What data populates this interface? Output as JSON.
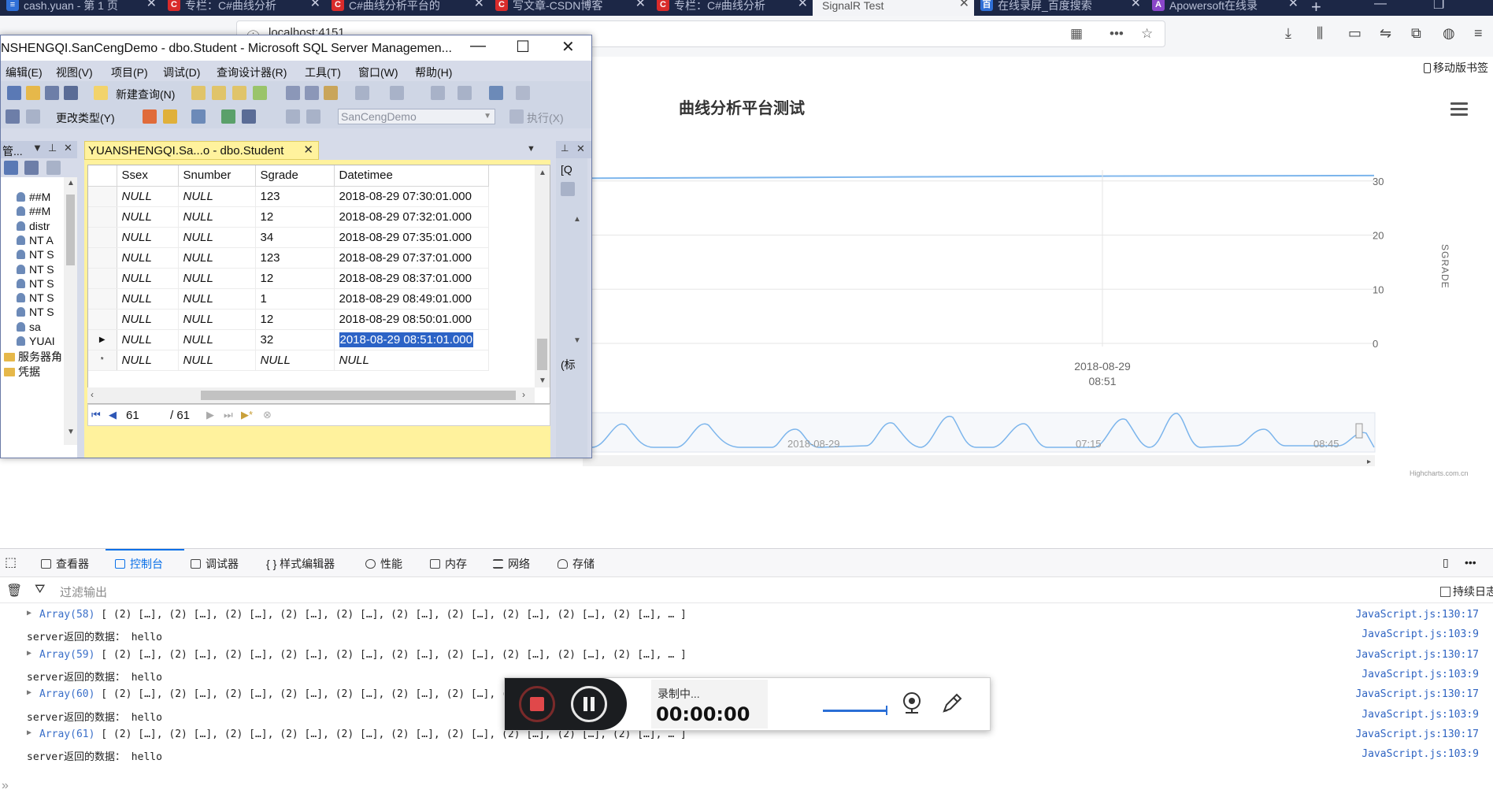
{
  "browser": {
    "tabs": [
      {
        "label": "cash.yuan - 第 1 页",
        "icon": "text-icon"
      },
      {
        "label": "专栏：C#曲线分析",
        "icon": "csdn-icon"
      },
      {
        "label": "C#曲线分析平台的",
        "icon": "csdn-icon"
      },
      {
        "label": "写文章-CSDN博客",
        "icon": "csdn-icon"
      },
      {
        "label": "专栏：C#曲线分析",
        "icon": "csdn-icon"
      },
      {
        "label": "SignalR Test",
        "icon": "none",
        "active": true
      },
      {
        "label": "在线录屏_百度搜索",
        "icon": "baidu-icon"
      },
      {
        "label": "Apowersoft在线录",
        "icon": "apowersoft-icon"
      }
    ],
    "url": "localhost:4151",
    "mobile_bookmarks": "移动版书签"
  },
  "chart": {
    "title": "曲线分析平台测试",
    "y_axis_title": "SGRADE",
    "credits": "Highcharts.com.cn",
    "nav_labels": [
      "2018-08-29",
      "07:15",
      "08:45"
    ]
  },
  "chart_data": {
    "type": "line",
    "title": "曲线分析平台测试",
    "ylabel": "SGRADE",
    "y_ticks": [
      0,
      10,
      20,
      30
    ],
    "ylim": [
      0,
      32
    ],
    "x_tick_label": [
      "2018-08-29",
      "08:51"
    ],
    "series": [
      {
        "values": [
          30.5,
          30.7,
          30.9,
          31.0
        ]
      }
    ]
  },
  "ssms": {
    "title": "NSHENGQI.SanCengDemo - dbo.Student - Microsoft SQL Server Managemen...",
    "menu": [
      "编辑(E)",
      "视图(V)",
      "项目(P)",
      "调试(D)",
      "查询设计器(R)",
      "工具(T)",
      "窗口(W)",
      "帮助(H)"
    ],
    "toolbar": {
      "new_query": "新建查询(N)",
      "change_type": "更改类型(Y)",
      "database": "SanCengDemo",
      "execute": "执行(X)"
    },
    "explorer": {
      "header": "管...",
      "items": [
        {
          "label": "##M",
          "type": "user"
        },
        {
          "label": "##M",
          "type": "user"
        },
        {
          "label": "distr",
          "type": "user"
        },
        {
          "label": "NT A",
          "type": "user"
        },
        {
          "label": "NT S",
          "type": "user"
        },
        {
          "label": "NT S",
          "type": "user"
        },
        {
          "label": "NT S",
          "type": "user"
        },
        {
          "label": "NT S",
          "type": "user"
        },
        {
          "label": "NT S",
          "type": "user"
        },
        {
          "label": "sa",
          "type": "user"
        },
        {
          "label": "YUAI",
          "type": "user"
        },
        {
          "label": "服务器角",
          "type": "folder"
        },
        {
          "label": "凭据",
          "type": "folder"
        }
      ]
    },
    "doc_tab": "YUANSHENGQI.Sa...o - dbo.Student",
    "grid": {
      "columns": [
        "Ssex",
        "Snumber",
        "Sgrade",
        "Datetimee"
      ],
      "rows": [
        [
          "NULL",
          "NULL",
          "123",
          "2018-08-29 07:30:01.000"
        ],
        [
          "NULL",
          "NULL",
          "12",
          "2018-08-29 07:32:01.000"
        ],
        [
          "NULL",
          "NULL",
          "34",
          "2018-08-29 07:35:01.000"
        ],
        [
          "NULL",
          "NULL",
          "123",
          "2018-08-29 07:37:01.000"
        ],
        [
          "NULL",
          "NULL",
          "12",
          "2018-08-29 08:37:01.000"
        ],
        [
          "NULL",
          "NULL",
          "1",
          "2018-08-29 08:49:01.000"
        ],
        [
          "NULL",
          "NULL",
          "12",
          "2018-08-29 08:50:01.000"
        ],
        [
          "NULL",
          "NULL",
          "32",
          "2018-08-29 08:51:01.000"
        ],
        [
          "NULL",
          "NULL",
          "NULL",
          "NULL"
        ]
      ]
    },
    "nav": {
      "current": "61",
      "total": "/ 61"
    },
    "side_panel": [
      "[Q",
      "(标"
    ]
  },
  "devtools": {
    "tabs": [
      {
        "label": "查看器",
        "icon": "inspector-icon"
      },
      {
        "label": "控制台",
        "icon": "console-icon",
        "active": true
      },
      {
        "label": "调试器",
        "icon": "debugger-icon"
      },
      {
        "label": "{ } 样式编辑器",
        "icon": "style-icon"
      },
      {
        "label": "性能",
        "icon": "performance-icon"
      },
      {
        "label": "内存",
        "icon": "memory-icon"
      },
      {
        "label": "网络",
        "icon": "network-icon"
      },
      {
        "label": "存储",
        "icon": "storage-icon"
      }
    ],
    "filter_placeholder": "过滤输出",
    "persist_logs": "持续日志",
    "logs": [
      {
        "kind": "array",
        "name": "Array(58)",
        "body": " [ (2) […], (2) […], (2) […], (2) […], (2) […], (2) […], (2) […], (2) […], (2) […], (2) […], … ]",
        "src": "JavaScript.js:130:17"
      },
      {
        "kind": "msg",
        "body": "server返回的数据：  hello",
        "src": "JavaScript.js:103:9"
      },
      {
        "kind": "array",
        "name": "Array(59)",
        "body": " [ (2) […], (2) […], (2) […], (2) […], (2) […], (2) […], (2) […], (2) […], (2) […], (2) […], … ]",
        "src": "JavaScript.js:130:17"
      },
      {
        "kind": "msg",
        "body": "server返回的数据：  hello",
        "src": "JavaScript.js:103:9"
      },
      {
        "kind": "array",
        "name": "Array(60)",
        "body": " [ (2) […], (2) […], (2) […], (2) […], (2) […], (2) […], (2) […], (2) […], (2) […], (2) […], … ]",
        "src": "JavaScript.js:130:17"
      },
      {
        "kind": "msg",
        "body": "server返回的数据：  hello",
        "src": "JavaScript.js:103:9"
      },
      {
        "kind": "array",
        "name": "Array(61)",
        "body": " [ (2) […], (2) […], (2) […], (2) […], (2) […], (2) […], (2) […], (2) […], (2) […], (2) […], … ]",
        "src": "JavaScript.js:130:17"
      },
      {
        "kind": "msg",
        "body": "server返回的数据：  hello",
        "src": "JavaScript.js:103:9"
      }
    ]
  },
  "recorder": {
    "status": "录制中...",
    "time": "00:00:00"
  },
  "colors": {
    "line": "#7cb5ec",
    "accent": "#0a70e8",
    "selection": "#2c63c6",
    "doc_tab": "#fff29d"
  }
}
